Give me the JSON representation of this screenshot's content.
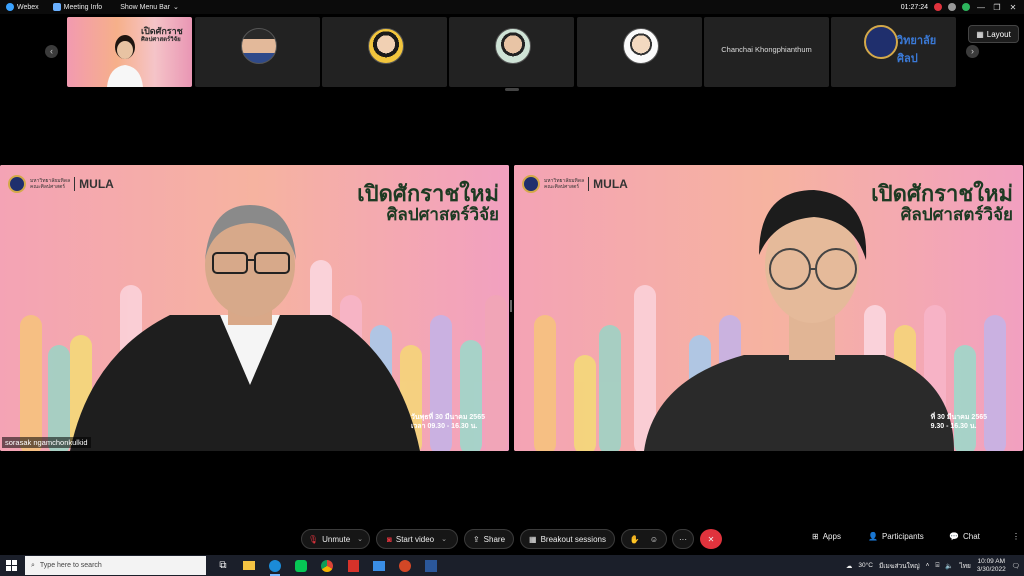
{
  "titlebar": {
    "app_name": "Webex",
    "meeting_info": "Meeting Info",
    "show_menu_bar": "Show Menu Bar",
    "timer": "01:27:24"
  },
  "strip": {
    "participants": [
      {
        "type": "self",
        "title_line1": "เปิดศักราช",
        "title_line2": "ศิลปศาสตร์วิจัย"
      },
      {
        "type": "avatar",
        "color": "#2f4a8a"
      },
      {
        "type": "avatar",
        "color": "#f2c53d"
      },
      {
        "type": "avatar",
        "color": "#7fb39a"
      },
      {
        "type": "avatar",
        "color": "#f0f0f0"
      },
      {
        "type": "name",
        "name": "Chanchai Khongphianthum"
      },
      {
        "type": "logo",
        "text": "วิทยาลัยศิลป"
      }
    ],
    "layout_label": "Layout"
  },
  "tiles": [
    {
      "univ_line1": "มหาวิทยาลัยมหิดล",
      "univ_line2": "คณะศิลปศาสตร์",
      "brand_mu": "MU",
      "brand_la": "LA",
      "headline_1": "เปิดศักราชใหม่",
      "headline_2": "ศิลปศาสตร์วิจัย",
      "date_line1": "วันพุธที่ 30 มีนาคม 2565",
      "date_line2": "เวลา 09.30 - 16.30 น.",
      "name": "sorasak ngamchonkulkid"
    },
    {
      "univ_line1": "มหาวิทยาลัยมหิดล",
      "univ_line2": "คณะศิลปศาสตร์",
      "brand_mu": "MU",
      "brand_la": "LA",
      "headline_1": "เปิดศักราชใหม่",
      "headline_2": "ศิลปศาสตร์วิจัย",
      "date_line1": "ที่ 30 มีนาคม 2565",
      "date_line2": "9.30 - 16.30 น.",
      "name": ""
    }
  ],
  "controls": {
    "unmute": "Unmute",
    "start_video": "Start video",
    "share": "Share",
    "breakout": "Breakout sessions",
    "more": "···",
    "apps": "Apps",
    "participants": "Participants",
    "chat": "Chat"
  },
  "taskbar": {
    "search_placeholder": "Type here to search",
    "weather": "30°C",
    "weather_desc": "มีเมฆส่วนใหญ่",
    "lang": "ไทย",
    "time": "10:09 AM",
    "date": "3/30/2022"
  },
  "colors": {
    "leave_red": "#e0333d",
    "bg_pink": "#f2a9b8",
    "headline_green": "#1d3a23"
  }
}
